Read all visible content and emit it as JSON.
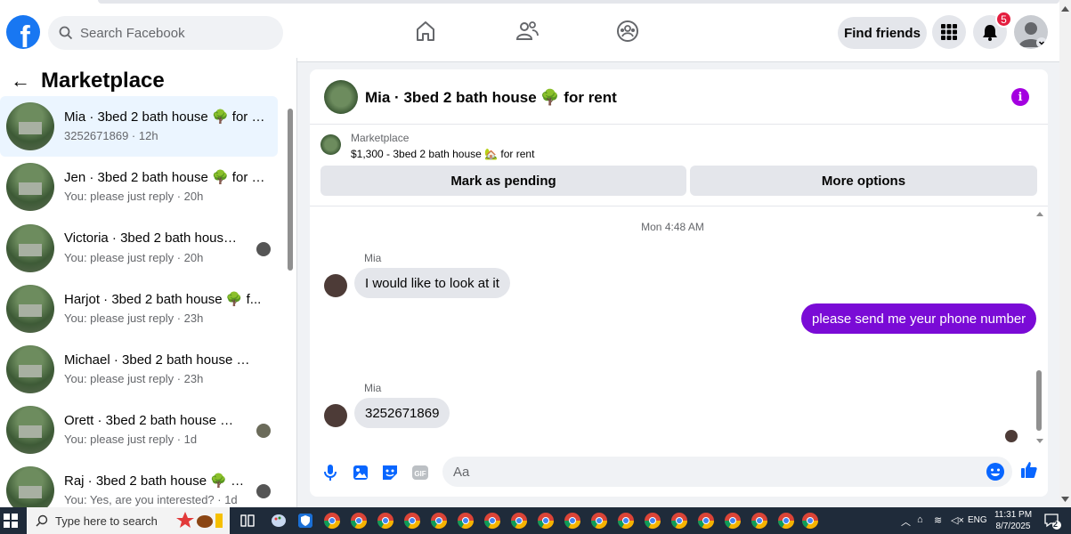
{
  "topbar": {
    "logo": "f",
    "search_placeholder": "Search Facebook",
    "find_friends_label": "Find friends",
    "notification_count": "5",
    "nav_icons": [
      "home-icon",
      "friends-icon",
      "groups-icon"
    ]
  },
  "sidebar": {
    "title": "Marketplace",
    "conversations": [
      {
        "name": "Mia · 3bed 2 bath house 🌳 for r...",
        "sub": "3252671869 · 12h",
        "active": true
      },
      {
        "name": "Jen · 3bed 2 bath house 🌳 for r...",
        "sub": "You: please just reply · 20h"
      },
      {
        "name": "Victoria · 3bed 2 bath house ...",
        "sub": "You: please just reply · 20h"
      },
      {
        "name": "Harjot · 3bed 2 bath house 🌳 f...",
        "sub": "You: please just reply · 23h"
      },
      {
        "name": "Michael · 3bed 2 bath house 🌳 ...",
        "sub": "You: please just reply · 23h"
      },
      {
        "name": "Orett · 3bed 2 bath house 🌳 ...",
        "sub": "You: please just reply · 1d"
      },
      {
        "name": "Raj · 3bed 2 bath house 🌳 fo...",
        "sub": "You: Yes, are you interested? · 1d"
      }
    ]
  },
  "chat": {
    "title": "Mia · 3bed 2 bath house 🌳 for rent",
    "listing_source": "Marketplace",
    "listing_text": "$1,300 - 3bed 2 bath house 🏡 for rent",
    "mark_pending_label": "Mark as pending",
    "more_options_label": "More options",
    "timestamp": "Mon 4:48 AM",
    "messages": [
      {
        "sender": "Mia",
        "text": "I would like to look at it",
        "dir": "in"
      },
      {
        "text": "please send me yeur  phone number",
        "dir": "out"
      },
      {
        "sender": "Mia",
        "text": "3252671869",
        "dir": "in"
      }
    ],
    "composer_placeholder": "Aa"
  },
  "taskbar": {
    "search_placeholder": "Type here to search",
    "lang": "ENG",
    "time": "11:31 PM",
    "date": "8/7/2025",
    "notif_count": "2"
  },
  "colors": {
    "brand": "#1877f2",
    "messenger_purple": "#7a0bd6",
    "notification_red": "#e41e3f"
  }
}
